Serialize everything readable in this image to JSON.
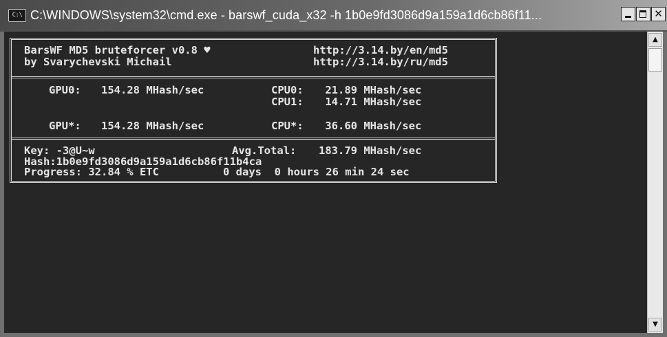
{
  "window": {
    "title": "C:\\WINDOWS\\system32\\cmd.exe - barswf_cuda_x32 -h 1b0e9fd3086d9a159a1d6cb86f11...",
    "icon_text": "C:\\",
    "buttons": {
      "minimize": "minimize-icon",
      "maximize": "maximize-icon",
      "close": "close-icon"
    }
  },
  "console": {
    "header": {
      "app_line": "BarsWF MD5 bruteforcer v0.8 ♥",
      "author_line": "by Svarychevski Michail",
      "url_en": "http://3.14.by/en/md5",
      "url_ru": "http://3.14.by/ru/md5"
    },
    "speeds": {
      "gpu0_label": "GPU0:",
      "gpu0_value": "154.28 MHash/sec",
      "cpu0_label": "CPU0:",
      "cpu0_value": " 21.89 MHash/sec",
      "cpu1_label": "CPU1:",
      "cpu1_value": " 14.71 MHash/sec",
      "gpu_total_label": "GPU*:",
      "gpu_total_value": "154.28 MHash/sec",
      "cpu_total_label": "CPU*:",
      "cpu_total_value": " 36.60 MHash/sec"
    },
    "status": {
      "key_line": "Key: -3@U~w",
      "avg_label": "Avg.Total:",
      "avg_value": "183.79 MHash/sec",
      "hash_line": "Hash:1b0e9fd3086d9a159a1d6cb86f11b4ca",
      "progress_line": "Progress: 32.84 % ETC",
      "etc_line": "0 days  0 hours 26 min 24 sec"
    }
  },
  "colors": {
    "console_bg": "#262626",
    "console_text": "#e6e6e6",
    "titlebar_text": "#ffffff"
  }
}
